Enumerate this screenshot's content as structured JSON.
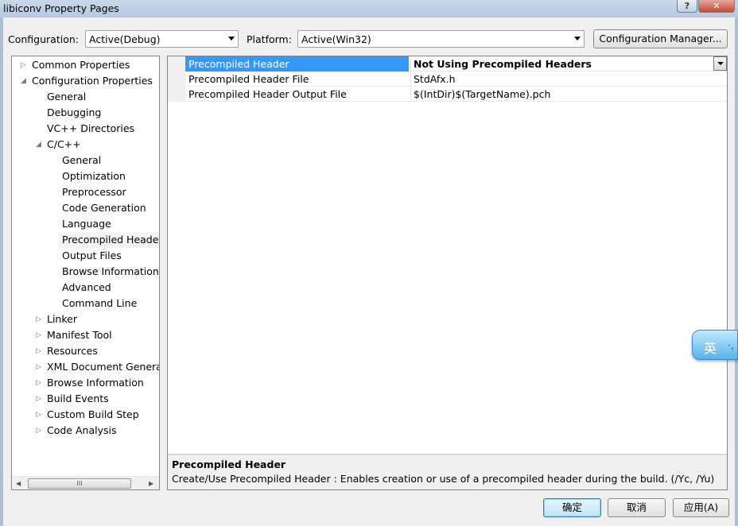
{
  "window": {
    "title": "libiconv Property Pages",
    "help_glyph": "?",
    "close_glyph": "✕"
  },
  "config_bar": {
    "configuration_label": "Configuration:",
    "configuration_value": "Active(Debug)",
    "platform_label": "Platform:",
    "platform_value": "Active(Win32)",
    "manager_button": "Configuration Manager..."
  },
  "tree": {
    "items": [
      {
        "label": "Common Properties",
        "expander": "▷"
      },
      {
        "label": "Configuration Properties",
        "expander": "◢"
      },
      {
        "label": "General"
      },
      {
        "label": "Debugging"
      },
      {
        "label": "VC++ Directories"
      },
      {
        "label": "C/C++",
        "expander": "◢"
      },
      {
        "label": "General"
      },
      {
        "label": "Optimization"
      },
      {
        "label": "Preprocessor"
      },
      {
        "label": "Code Generation"
      },
      {
        "label": "Language"
      },
      {
        "label": "Precompiled Header",
        "selected": true
      },
      {
        "label": "Output Files"
      },
      {
        "label": "Browse Information"
      },
      {
        "label": "Advanced"
      },
      {
        "label": "Command Line"
      },
      {
        "label": "Linker",
        "expander": "▷"
      },
      {
        "label": "Manifest Tool",
        "expander": "▷"
      },
      {
        "label": "Resources",
        "expander": "▷"
      },
      {
        "label": "XML Document Generat",
        "expander": "▷"
      },
      {
        "label": "Browse Information",
        "expander": "▷"
      },
      {
        "label": "Build Events",
        "expander": "▷"
      },
      {
        "label": "Custom Build Step",
        "expander": "▷"
      },
      {
        "label": "Code Analysis",
        "expander": "▷"
      }
    ],
    "scroll_left": "◀",
    "scroll_right": "▶",
    "thumb_grip": "III"
  },
  "properties": {
    "rows": [
      {
        "name": "Precompiled Header",
        "value": "Not Using Precompiled Headers",
        "selected": true
      },
      {
        "name": "Precompiled Header File",
        "value": "StdAfx.h"
      },
      {
        "name": "Precompiled Header Output File",
        "value": "$(IntDir)$(TargetName).pch"
      }
    ]
  },
  "description": {
    "title": "Precompiled Header",
    "text": "Create/Use Precompiled Header : Enables creation or use of a precompiled header during the build.      (/Yc, /Yu)"
  },
  "buttons": {
    "ok": "确定",
    "cancel": "取消",
    "apply": "应用(A)"
  },
  "ime": {
    "char": "英",
    "dots": "·,"
  },
  "colors": {
    "selection": "#3399ff",
    "titlebar": "#b7c9df",
    "close": "#c44b38"
  }
}
